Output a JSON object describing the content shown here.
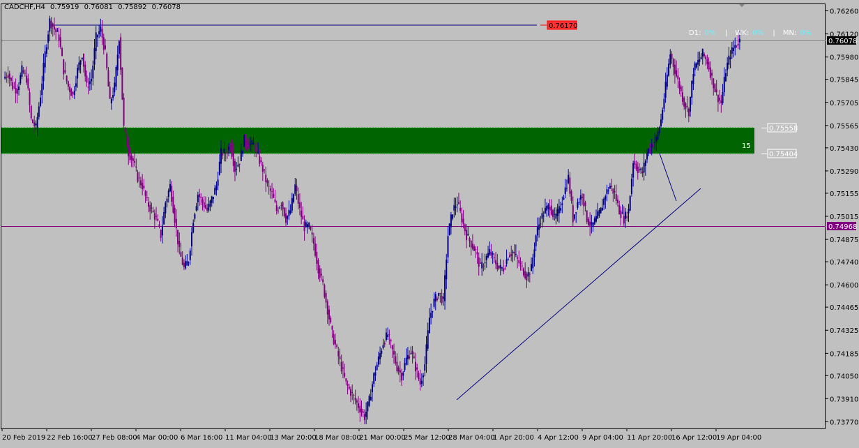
{
  "symbol_info": {
    "symbol": "CADCHF,H4",
    "open": "0.75919",
    "high": "0.76081",
    "low": "0.75892",
    "close": "0.76078"
  },
  "timeframe_status": {
    "d1_label": "D1:",
    "d1_value": "0%",
    "wk_label": "WK:",
    "wk_value": "0%",
    "mn_label": "MN:",
    "mn_value": "0%",
    "separator": "|"
  },
  "price_scale": [
    "0.76260",
    "0.76120",
    "0.75980",
    "0.75845",
    "0.75705",
    "0.75565",
    "0.75430",
    "0.75290",
    "0.75155",
    "0.75015",
    "0.74875",
    "0.74740",
    "0.74600",
    "0.74465",
    "0.74325",
    "0.74185",
    "0.74050",
    "0.73910",
    "0.73770"
  ],
  "time_scale": [
    "20 Feb 2019",
    "22 Feb 16:00",
    "27 Feb 08:00",
    "4 Mar 00:00",
    "6 Mar 16:00",
    "11 Mar 04:00",
    "13 Mar 20:00",
    "18 Mar 08:00",
    "21 Mar 00:00",
    "25 Mar 12:00",
    "28 Mar 04:00",
    "1 Apr 20:00",
    "4 Apr 12:00",
    "9 Apr 04:00",
    "11 Apr 20:00",
    "16 Apr 12:00",
    "19 Apr 04:00"
  ],
  "current_price_label": "0.76078",
  "horizontal_line_label": "0.74968",
  "resistance_label": "0.76170",
  "zone": {
    "top_label": "0.75558",
    "bottom_label": "0.75404",
    "text": "15",
    "color": "#006400"
  },
  "chart_data": {
    "type": "candlestick",
    "symbol": "CADCHF",
    "timeframe": "H4",
    "ohlc_last": {
      "open": 0.75919,
      "high": 0.76081,
      "low": 0.75892,
      "close": 0.76078
    },
    "ylim": [
      0.7373,
      0.763
    ],
    "levels": [
      {
        "name": "current",
        "price": 0.76078
      },
      {
        "name": "horizontal",
        "price": 0.74968
      },
      {
        "name": "resistance",
        "price": 0.7617
      },
      {
        "name": "zone-top",
        "price": 0.75558
      },
      {
        "name": "zone-bottom",
        "price": 0.75404
      }
    ],
    "close_path": [
      0.7585,
      0.7588,
      0.758,
      0.7578,
      0.759,
      0.7585,
      0.756,
      0.7555,
      0.7575,
      0.76,
      0.762,
      0.7615,
      0.761,
      0.759,
      0.758,
      0.7575,
      0.759,
      0.76,
      0.758,
      0.7585,
      0.761,
      0.7615,
      0.76,
      0.757,
      0.758,
      0.761,
      0.7555,
      0.754,
      0.7535,
      0.7525,
      0.752,
      0.751,
      0.7505,
      0.75,
      0.749,
      0.751,
      0.752,
      0.75,
      0.748,
      0.747,
      0.7475,
      0.75,
      0.7515,
      0.751,
      0.7505,
      0.7512,
      0.752,
      0.754,
      0.754,
      0.7545,
      0.753,
      0.7535,
      0.7548,
      0.7545,
      0.7545,
      0.7538,
      0.753,
      0.752,
      0.7515,
      0.7505,
      0.751,
      0.75,
      0.7505,
      0.752,
      0.7505,
      0.7495,
      0.7495,
      0.7485,
      0.747,
      0.746,
      0.7445,
      0.743,
      0.742,
      0.741,
      0.74,
      0.7395,
      0.739,
      0.7385,
      0.738,
      0.739,
      0.7405,
      0.7415,
      0.7425,
      0.743,
      0.742,
      0.741,
      0.7405,
      0.7415,
      0.742,
      0.741,
      0.74,
      0.7412,
      0.744,
      0.745,
      0.7455,
      0.745,
      0.749,
      0.7505,
      0.751,
      0.75,
      0.749,
      0.7485,
      0.748,
      0.747,
      0.7475,
      0.748,
      0.7475,
      0.747,
      0.747,
      0.7478,
      0.748,
      0.7475,
      0.747,
      0.7465,
      0.747,
      0.749,
      0.75,
      0.7505,
      0.7508,
      0.75,
      0.7505,
      0.7515,
      0.7525,
      0.75,
      0.751,
      0.7515,
      0.75,
      0.7495,
      0.75,
      0.7505,
      0.7515,
      0.752,
      0.7515,
      0.7505,
      0.75,
      0.7505,
      0.7535,
      0.753,
      0.7528,
      0.754,
      0.7545,
      0.7548,
      0.756,
      0.758,
      0.76,
      0.759,
      0.758,
      0.757,
      0.7565,
      0.759,
      0.7595,
      0.76,
      0.7595,
      0.7585,
      0.7575,
      0.757,
      0.759,
      0.76,
      0.7605,
      0.7608
    ]
  }
}
